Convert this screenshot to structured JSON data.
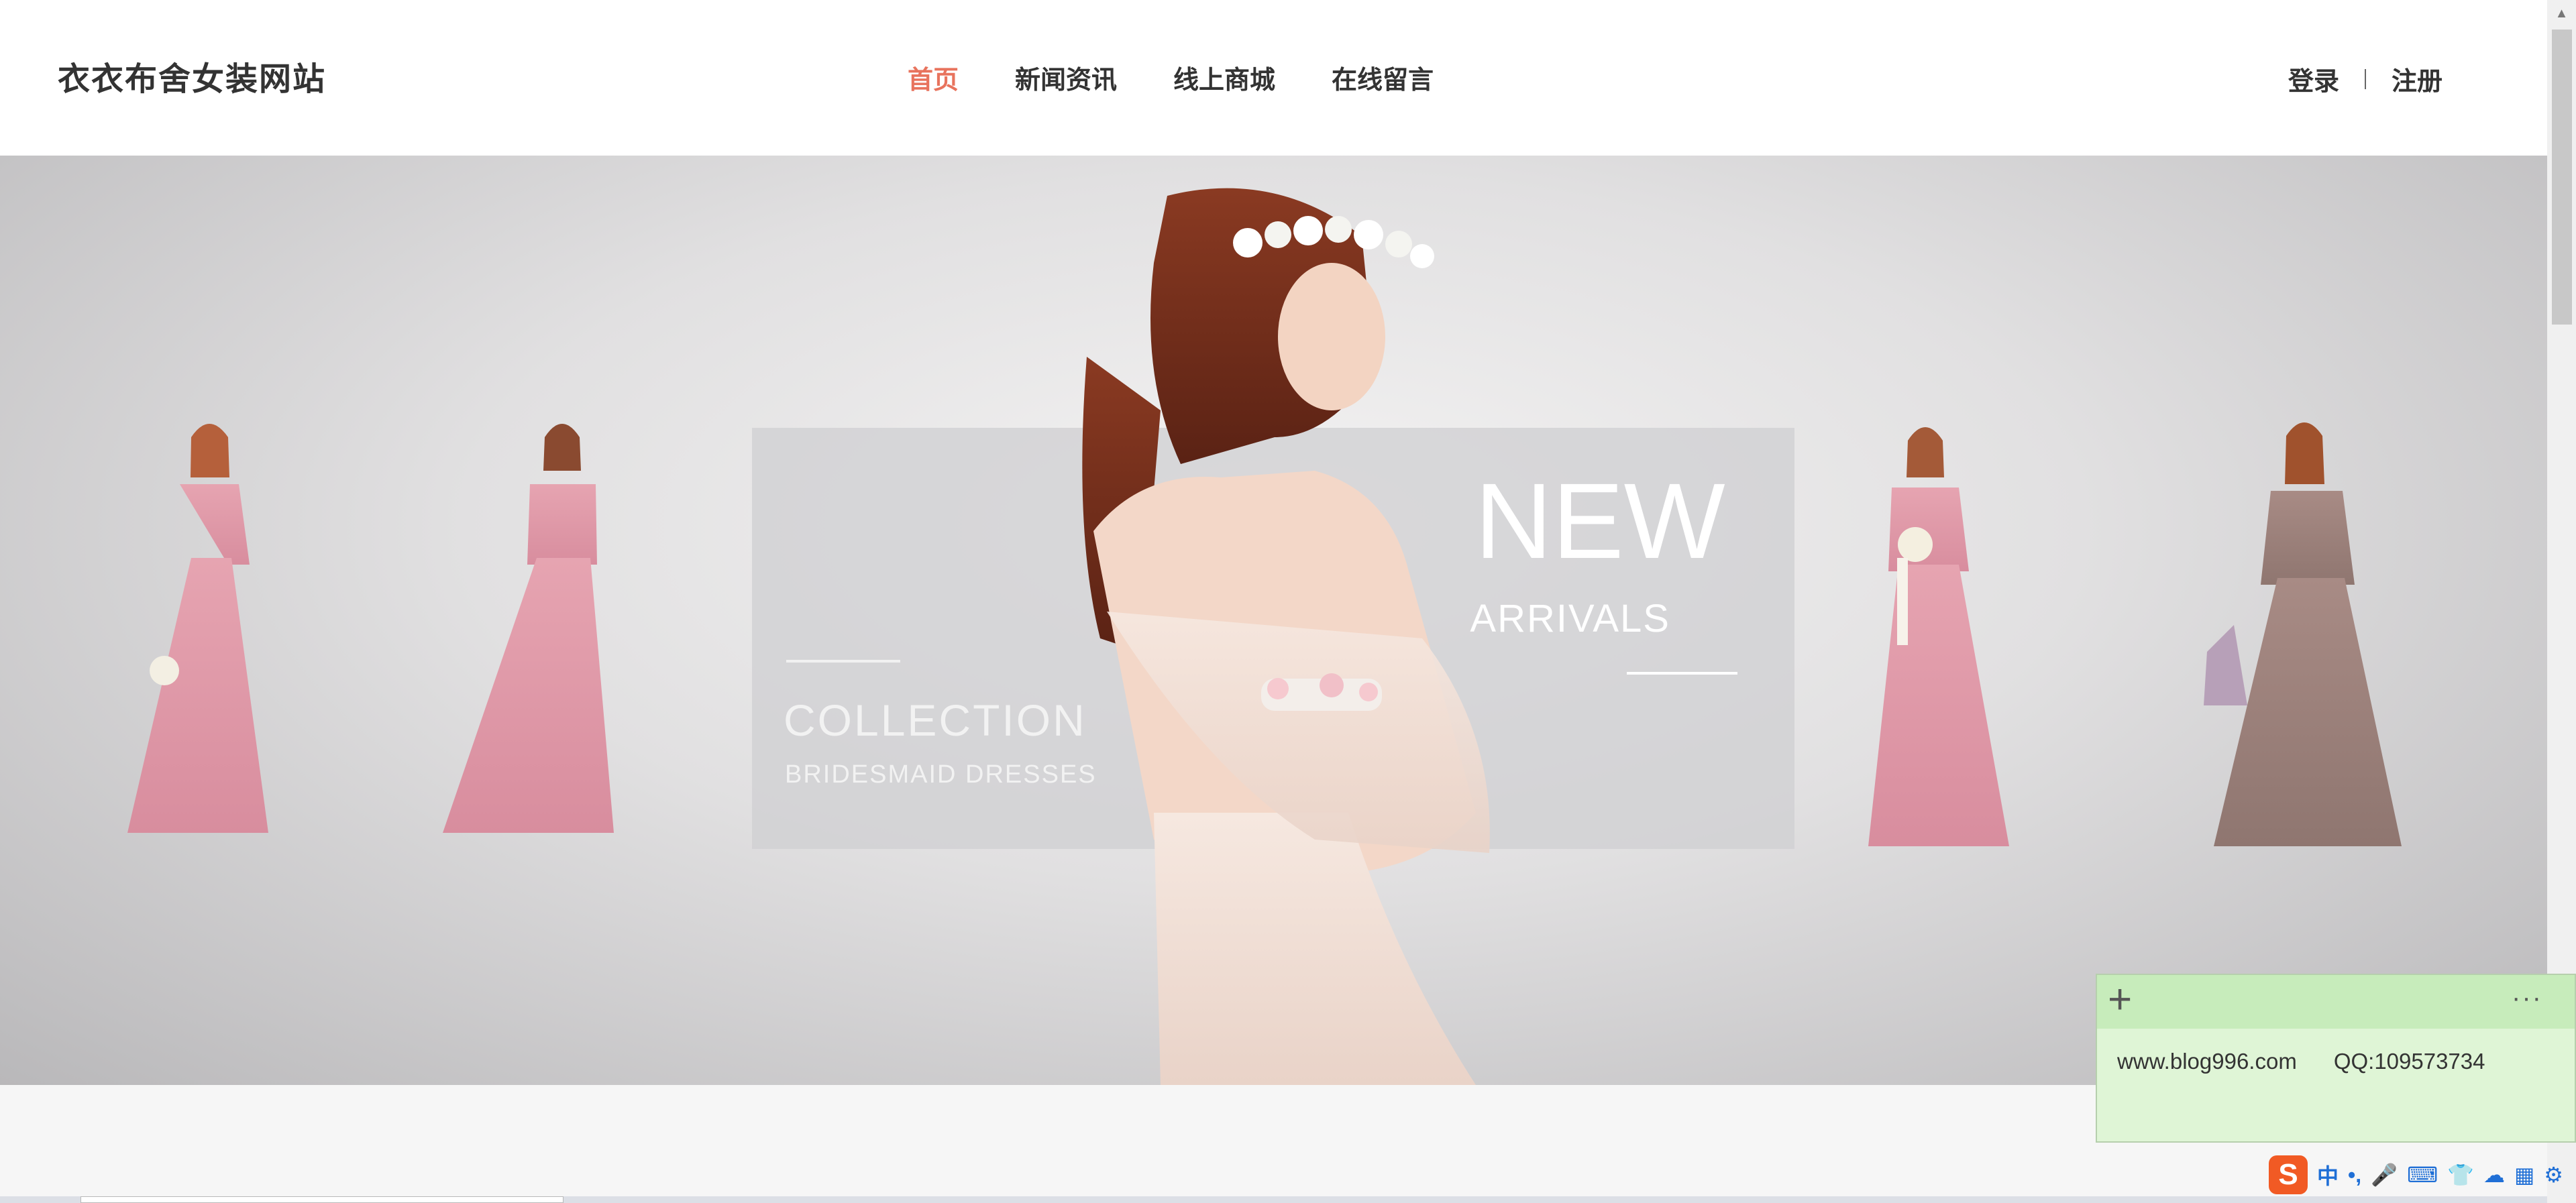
{
  "header": {
    "logo": "衣衣布舍女装网站",
    "nav": [
      {
        "label": "首页",
        "active": true
      },
      {
        "label": "新闻资讯",
        "active": false
      },
      {
        "label": "线上商城",
        "active": false
      },
      {
        "label": "在线留言",
        "active": false
      }
    ],
    "login": "登录",
    "register": "注册"
  },
  "banner": {
    "headline": "NEW",
    "subhead": "ARRIVALS",
    "collection": "COLLECTION",
    "collection_sub": "BRIDESMAID DRESSES"
  },
  "sticky_note": {
    "add_symbol": "+",
    "more_symbol": "···",
    "text": "www.blog996.com      QQ:109573734"
  },
  "ime": {
    "logo": "S",
    "items": [
      "中",
      "•,",
      "🎤",
      "⌨",
      "👕",
      "☁",
      "▦",
      "⚙"
    ]
  },
  "colors": {
    "accent": "#e8735d",
    "text": "#333333",
    "note_bg": "#dff5d6",
    "note_bar": "#c7ecbb"
  }
}
